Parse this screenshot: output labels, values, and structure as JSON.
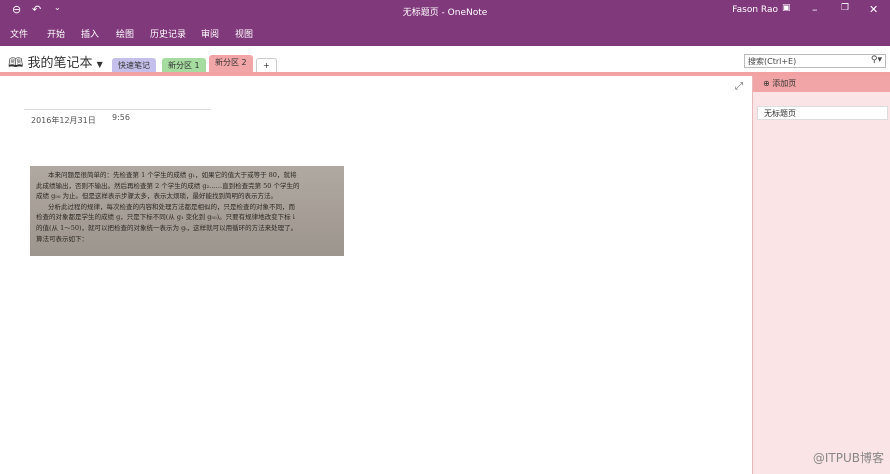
{
  "window": {
    "title": "无标题页 - OneNote",
    "user": "Fason Rao"
  },
  "ribbon": {
    "tabs": [
      "文件",
      "开始",
      "插入",
      "绘图",
      "历史记录",
      "审阅",
      "视图"
    ]
  },
  "notebook": {
    "name": "我的笔记本",
    "sections": [
      "快速笔记",
      "新分区 1",
      "新分区 2"
    ],
    "add_section": "+"
  },
  "search": {
    "placeholder": "搜索(Ctrl+E)"
  },
  "page": {
    "date": "2016年12月31日",
    "time": "9:56",
    "image_text": [
      "本来问题是很简单的：先检查第 1 个学生的成绩 g₁，如果它的值大于或等于 80，就将",
      "此成绩输出，否则不输出。然后再检查第 2 个学生的成绩 g₂……直到检查完第 50 个学生的",
      "成绩 g₅₀ 为止。但是这样表示步骤太多，表示太烦琐，最好能找到简明的表示方法。",
      "分析此过程的规律，每次检查的内容和处理方法都是相似的，只是检查的对象不同，而",
      "检查的对象都是学生的成绩 g，只是下标不同(从 g₁ 变化到 g₅₀)。只要有规律地改变下标 i",
      "的值(从 1～50)，就可以把检查的对象统一表示为 gᵢ，这样就可以用循环的方法来处理了。",
      "算法可表示如下："
    ]
  },
  "pages_panel": {
    "add_page": "添加页",
    "pages": [
      "无标题页"
    ]
  },
  "watermark": "@ITPUB博客"
}
